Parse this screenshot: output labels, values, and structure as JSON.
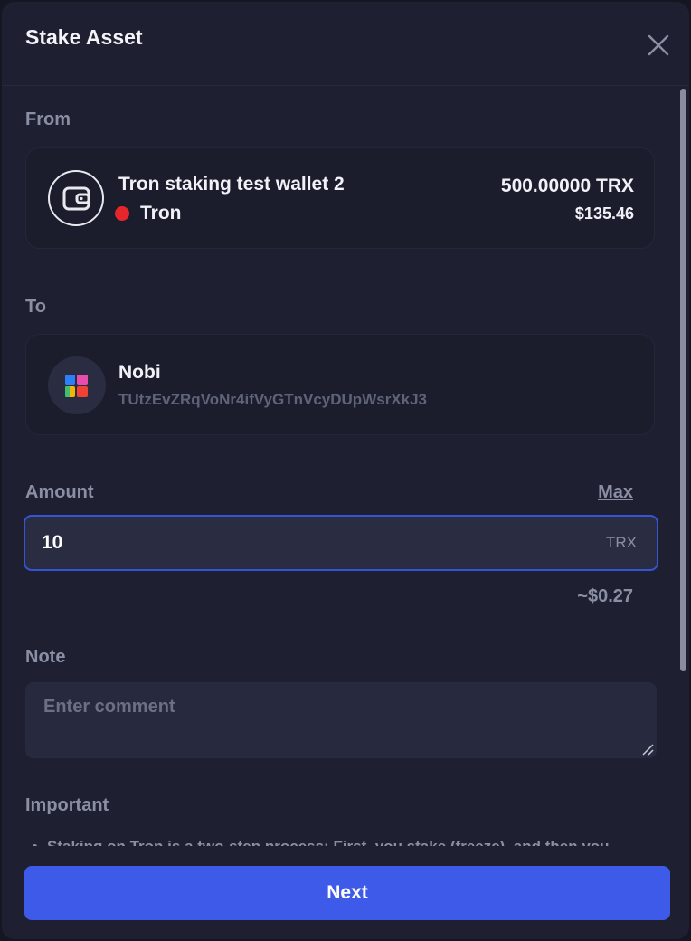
{
  "modal": {
    "title": "Stake Asset"
  },
  "from": {
    "label": "From",
    "wallet_name": "Tron staking test wallet 2",
    "network": "Tron",
    "balance": "500.00000 TRX",
    "balance_usd": "$135.46",
    "network_color": "#e5262b"
  },
  "to": {
    "label": "To",
    "validator_name": "Nobi",
    "validator_address": "TUtzEvZRqVoNr4ifVyGTnVcyDUpWsrXkJ3"
  },
  "amount": {
    "label": "Amount",
    "max_label": "Max",
    "value": "10",
    "unit": "TRX",
    "fiat_estimate": "~$0.27"
  },
  "note": {
    "label": "Note",
    "placeholder": "Enter comment"
  },
  "important": {
    "label": "Important",
    "text": "Staking on Tron is a two-step process: First, you stake (freeze), and then you"
  },
  "footer": {
    "next_label": "Next"
  },
  "colors": {
    "accent": "#3d5ae9",
    "focus_border": "#3654d6",
    "background": "#1e2032"
  },
  "icons": {
    "close": "close-icon",
    "wallet": "wallet-icon",
    "validator": "nobi-logo-icon"
  }
}
